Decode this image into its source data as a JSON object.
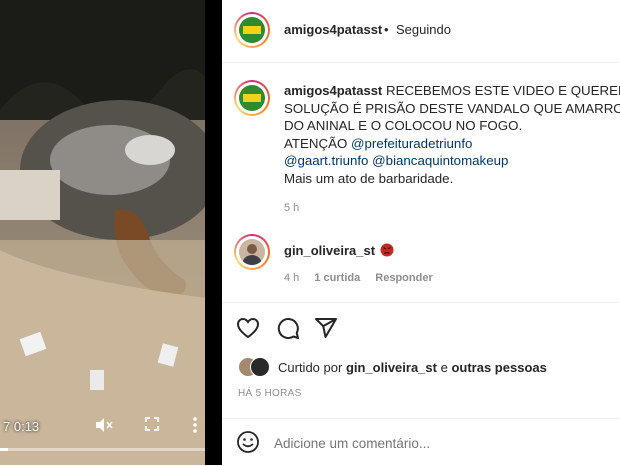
{
  "video": {
    "current_time": "0:13",
    "time_prefix": "7",
    "progress_fraction": 0.04,
    "mute_icon": "mute-icon",
    "fullscreen_icon": "fullscreen-icon",
    "more_icon": "more-vertical-icon"
  },
  "header": {
    "username": "amigos4patasst",
    "separator": "•",
    "follow_status": "Seguindo"
  },
  "caption": {
    "username": "amigos4patasst",
    "line1": "RECEBEMOS ESTE VIDEO E QUEREMOS",
    "line2": "SOLUÇÃO É PRISÃO DESTE VANDALO QUE AMARROU A",
    "line3": "DO ANINAL E O COLOCOU NO FOGO.",
    "line4_prefix": "ATENÇÃO",
    "mention1": "@prefeituradetriunfo",
    "mention2": "@gaart.triunfo",
    "mention3": "@biancaquintomakeup",
    "line6": "Mais um ato de barbaridade.",
    "time": "5 h"
  },
  "comment": {
    "username": "gin_oliveira_st",
    "emoji": "angry-face",
    "time": "4 h",
    "likes": "1 curtida",
    "reply": "Responder"
  },
  "actions": {
    "like_icon": "heart-icon",
    "comment_icon": "comment-icon",
    "share_icon": "share-icon",
    "liked_by_prefix": "Curtido por",
    "liked_by_user": "gin_oliveira_st",
    "liked_by_connector": "e",
    "liked_by_others": "outras pessoas",
    "timestamp": "HÁ 5 HORAS"
  },
  "add_comment": {
    "placeholder": "Adicione um comentário...",
    "emoji_icon": "smiley-icon"
  },
  "colors": {
    "link": "#00376b",
    "muted": "#8e8e8e",
    "text": "#262626",
    "avatar_green": "#2e8b2e",
    "avatar_yellow": "#f2d21b"
  }
}
